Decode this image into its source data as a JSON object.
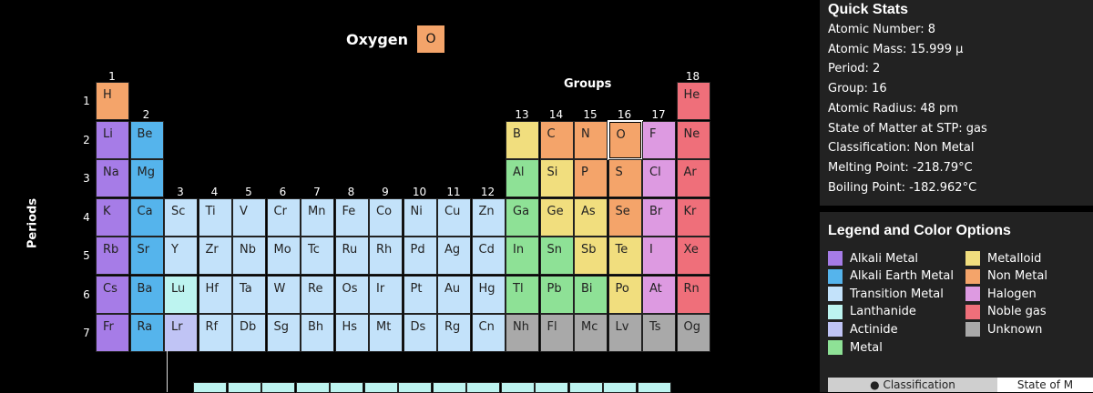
{
  "title": {
    "name": "Oxygen",
    "symbol": "O"
  },
  "groups_label": "Groups",
  "periods_label": "Periods",
  "group_numbers": [
    "1",
    "2",
    "3",
    "4",
    "5",
    "6",
    "7",
    "8",
    "9",
    "10",
    "11",
    "12",
    "13",
    "14",
    "15",
    "16",
    "17",
    "18"
  ],
  "period_numbers": [
    "1",
    "2",
    "3",
    "4",
    "5",
    "6",
    "7"
  ],
  "colors": {
    "alkali": "#a67ce7",
    "alkaline": "#55b4ec",
    "transition": "#c3e2fa",
    "lanthanide": "#bdf4f0",
    "actinide": "#c0c4f5",
    "metal": "#8ee196",
    "metalloid": "#f1de7e",
    "nonmetal": "#f4a46a",
    "halogen": "#dd9ae1",
    "noble": "#ef6f7a",
    "unknown": "#a9a9a9"
  },
  "elements": [
    {
      "s": "H",
      "g": 1,
      "p": 1,
      "c": "nonmetal"
    },
    {
      "s": "He",
      "g": 18,
      "p": 1,
      "c": "noble"
    },
    {
      "s": "Li",
      "g": 1,
      "p": 2,
      "c": "alkali"
    },
    {
      "s": "Be",
      "g": 2,
      "p": 2,
      "c": "alkaline"
    },
    {
      "s": "B",
      "g": 13,
      "p": 2,
      "c": "metalloid"
    },
    {
      "s": "C",
      "g": 14,
      "p": 2,
      "c": "nonmetal"
    },
    {
      "s": "N",
      "g": 15,
      "p": 2,
      "c": "nonmetal"
    },
    {
      "s": "O",
      "g": 16,
      "p": 2,
      "c": "nonmetal",
      "selected": true
    },
    {
      "s": "F",
      "g": 17,
      "p": 2,
      "c": "halogen"
    },
    {
      "s": "Ne",
      "g": 18,
      "p": 2,
      "c": "noble"
    },
    {
      "s": "Na",
      "g": 1,
      "p": 3,
      "c": "alkali"
    },
    {
      "s": "Mg",
      "g": 2,
      "p": 3,
      "c": "alkaline"
    },
    {
      "s": "Al",
      "g": 13,
      "p": 3,
      "c": "metal"
    },
    {
      "s": "Si",
      "g": 14,
      "p": 3,
      "c": "metalloid"
    },
    {
      "s": "P",
      "g": 15,
      "p": 3,
      "c": "nonmetal"
    },
    {
      "s": "S",
      "g": 16,
      "p": 3,
      "c": "nonmetal"
    },
    {
      "s": "Cl",
      "g": 17,
      "p": 3,
      "c": "halogen"
    },
    {
      "s": "Ar",
      "g": 18,
      "p": 3,
      "c": "noble"
    },
    {
      "s": "K",
      "g": 1,
      "p": 4,
      "c": "alkali"
    },
    {
      "s": "Ca",
      "g": 2,
      "p": 4,
      "c": "alkaline"
    },
    {
      "s": "Sc",
      "g": 3,
      "p": 4,
      "c": "transition"
    },
    {
      "s": "Ti",
      "g": 4,
      "p": 4,
      "c": "transition"
    },
    {
      "s": "V",
      "g": 5,
      "p": 4,
      "c": "transition"
    },
    {
      "s": "Cr",
      "g": 6,
      "p": 4,
      "c": "transition"
    },
    {
      "s": "Mn",
      "g": 7,
      "p": 4,
      "c": "transition"
    },
    {
      "s": "Fe",
      "g": 8,
      "p": 4,
      "c": "transition"
    },
    {
      "s": "Co",
      "g": 9,
      "p": 4,
      "c": "transition"
    },
    {
      "s": "Ni",
      "g": 10,
      "p": 4,
      "c": "transition"
    },
    {
      "s": "Cu",
      "g": 11,
      "p": 4,
      "c": "transition"
    },
    {
      "s": "Zn",
      "g": 12,
      "p": 4,
      "c": "transition"
    },
    {
      "s": "Ga",
      "g": 13,
      "p": 4,
      "c": "metal"
    },
    {
      "s": "Ge",
      "g": 14,
      "p": 4,
      "c": "metalloid"
    },
    {
      "s": "As",
      "g": 15,
      "p": 4,
      "c": "metalloid"
    },
    {
      "s": "Se",
      "g": 16,
      "p": 4,
      "c": "nonmetal"
    },
    {
      "s": "Br",
      "g": 17,
      "p": 4,
      "c": "halogen"
    },
    {
      "s": "Kr",
      "g": 18,
      "p": 4,
      "c": "noble"
    },
    {
      "s": "Rb",
      "g": 1,
      "p": 5,
      "c": "alkali"
    },
    {
      "s": "Sr",
      "g": 2,
      "p": 5,
      "c": "alkaline"
    },
    {
      "s": "Y",
      "g": 3,
      "p": 5,
      "c": "transition"
    },
    {
      "s": "Zr",
      "g": 4,
      "p": 5,
      "c": "transition"
    },
    {
      "s": "Nb",
      "g": 5,
      "p": 5,
      "c": "transition"
    },
    {
      "s": "Mo",
      "g": 6,
      "p": 5,
      "c": "transition"
    },
    {
      "s": "Tc",
      "g": 7,
      "p": 5,
      "c": "transition"
    },
    {
      "s": "Ru",
      "g": 8,
      "p": 5,
      "c": "transition"
    },
    {
      "s": "Rh",
      "g": 9,
      "p": 5,
      "c": "transition"
    },
    {
      "s": "Pd",
      "g": 10,
      "p": 5,
      "c": "transition"
    },
    {
      "s": "Ag",
      "g": 11,
      "p": 5,
      "c": "transition"
    },
    {
      "s": "Cd",
      "g": 12,
      "p": 5,
      "c": "transition"
    },
    {
      "s": "In",
      "g": 13,
      "p": 5,
      "c": "metal"
    },
    {
      "s": "Sn",
      "g": 14,
      "p": 5,
      "c": "metal"
    },
    {
      "s": "Sb",
      "g": 15,
      "p": 5,
      "c": "metalloid"
    },
    {
      "s": "Te",
      "g": 16,
      "p": 5,
      "c": "metalloid"
    },
    {
      "s": "I",
      "g": 17,
      "p": 5,
      "c": "halogen"
    },
    {
      "s": "Xe",
      "g": 18,
      "p": 5,
      "c": "noble"
    },
    {
      "s": "Cs",
      "g": 1,
      "p": 6,
      "c": "alkali"
    },
    {
      "s": "Ba",
      "g": 2,
      "p": 6,
      "c": "alkaline"
    },
    {
      "s": "Lu",
      "g": 3,
      "p": 6,
      "c": "lanthanide"
    },
    {
      "s": "Hf",
      "g": 4,
      "p": 6,
      "c": "transition"
    },
    {
      "s": "Ta",
      "g": 5,
      "p": 6,
      "c": "transition"
    },
    {
      "s": "W",
      "g": 6,
      "p": 6,
      "c": "transition"
    },
    {
      "s": "Re",
      "g": 7,
      "p": 6,
      "c": "transition"
    },
    {
      "s": "Os",
      "g": 8,
      "p": 6,
      "c": "transition"
    },
    {
      "s": "Ir",
      "g": 9,
      "p": 6,
      "c": "transition"
    },
    {
      "s": "Pt",
      "g": 10,
      "p": 6,
      "c": "transition"
    },
    {
      "s": "Au",
      "g": 11,
      "p": 6,
      "c": "transition"
    },
    {
      "s": "Hg",
      "g": 12,
      "p": 6,
      "c": "transition"
    },
    {
      "s": "Tl",
      "g": 13,
      "p": 6,
      "c": "metal"
    },
    {
      "s": "Pb",
      "g": 14,
      "p": 6,
      "c": "metal"
    },
    {
      "s": "Bi",
      "g": 15,
      "p": 6,
      "c": "metal"
    },
    {
      "s": "Po",
      "g": 16,
      "p": 6,
      "c": "metalloid"
    },
    {
      "s": "At",
      "g": 17,
      "p": 6,
      "c": "halogen"
    },
    {
      "s": "Rn",
      "g": 18,
      "p": 6,
      "c": "noble"
    },
    {
      "s": "Fr",
      "g": 1,
      "p": 7,
      "c": "alkali"
    },
    {
      "s": "Ra",
      "g": 2,
      "p": 7,
      "c": "alkaline"
    },
    {
      "s": "Lr",
      "g": 3,
      "p": 7,
      "c": "actinide"
    },
    {
      "s": "Rf",
      "g": 4,
      "p": 7,
      "c": "transition"
    },
    {
      "s": "Db",
      "g": 5,
      "p": 7,
      "c": "transition"
    },
    {
      "s": "Sg",
      "g": 6,
      "p": 7,
      "c": "transition"
    },
    {
      "s": "Bh",
      "g": 7,
      "p": 7,
      "c": "transition"
    },
    {
      "s": "Hs",
      "g": 8,
      "p": 7,
      "c": "transition"
    },
    {
      "s": "Mt",
      "g": 9,
      "p": 7,
      "c": "transition"
    },
    {
      "s": "Ds",
      "g": 10,
      "p": 7,
      "c": "transition"
    },
    {
      "s": "Rg",
      "g": 11,
      "p": 7,
      "c": "transition"
    },
    {
      "s": "Cn",
      "g": 12,
      "p": 7,
      "c": "transition"
    },
    {
      "s": "Nh",
      "g": 13,
      "p": 7,
      "c": "unknown"
    },
    {
      "s": "Fl",
      "g": 14,
      "p": 7,
      "c": "unknown"
    },
    {
      "s": "Mc",
      "g": 15,
      "p": 7,
      "c": "unknown"
    },
    {
      "s": "Lv",
      "g": 16,
      "p": 7,
      "c": "unknown"
    },
    {
      "s": "Ts",
      "g": 17,
      "p": 7,
      "c": "unknown"
    },
    {
      "s": "Og",
      "g": 18,
      "p": 7,
      "c": "unknown"
    }
  ],
  "quick_stats": {
    "title": "Quick Stats",
    "lines": [
      "Atomic Number: 8",
      "Atomic Mass: 15.999 μ",
      "Period: 2",
      "Group: 16",
      "Atomic Radius: 48 pm",
      "State of Matter at STP: gas",
      "Classification: Non Metal",
      "Melting Point: -218.79°C",
      "Boiling Point: -182.962°C"
    ]
  },
  "legend": {
    "title": "Legend and Color Options",
    "left": [
      {
        "label": "Alkali Metal",
        "c": "alkali"
      },
      {
        "label": "Alkali Earth Metal",
        "c": "alkaline"
      },
      {
        "label": "Transition Metal",
        "c": "transition"
      },
      {
        "label": "Lanthanide",
        "c": "lanthanide"
      },
      {
        "label": "Actinide",
        "c": "actinide"
      },
      {
        "label": "Metal",
        "c": "metal"
      }
    ],
    "right": [
      {
        "label": "Metalloid",
        "c": "metalloid"
      },
      {
        "label": "Non Metal",
        "c": "nonmetal"
      },
      {
        "label": "Halogen",
        "c": "halogen"
      },
      {
        "label": "Noble gas",
        "c": "noble"
      },
      {
        "label": "Unknown",
        "c": "unknown"
      }
    ]
  },
  "tabs": [
    {
      "label": "● Classification",
      "active": false
    },
    {
      "label": "State of M",
      "active": true
    }
  ]
}
